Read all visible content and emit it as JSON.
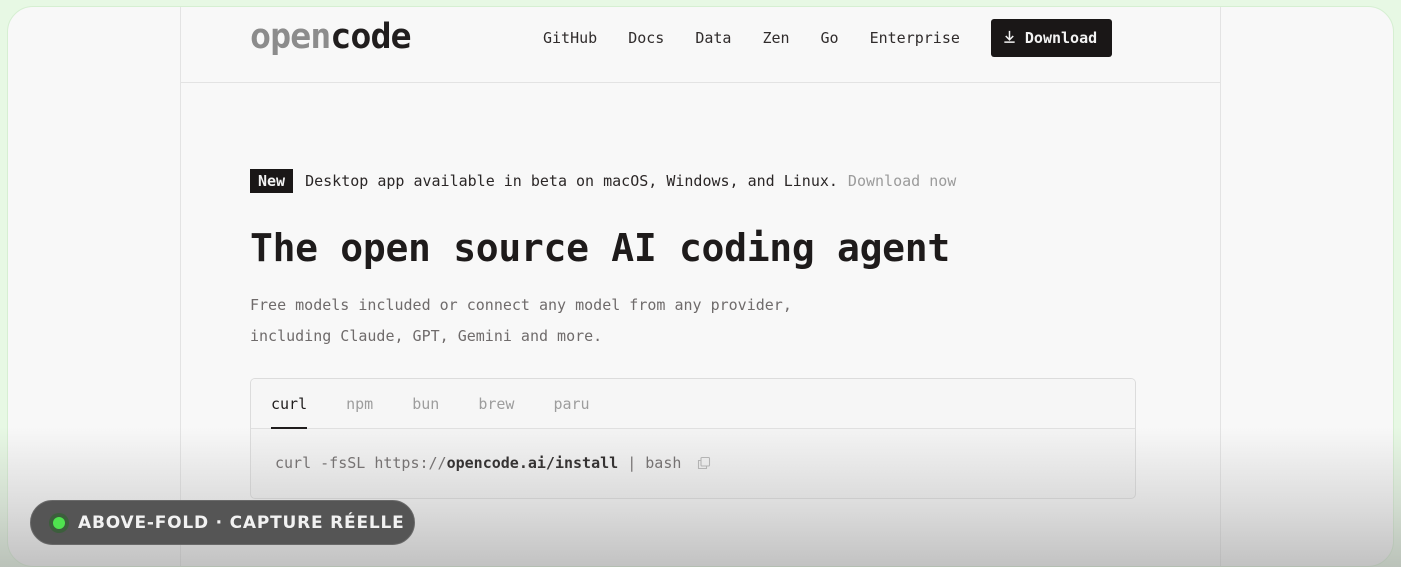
{
  "header": {
    "logo_dim": "open",
    "logo_strong": "code",
    "nav": [
      "GitHub",
      "Docs",
      "Data",
      "Zen",
      "Go",
      "Enterprise"
    ],
    "download_label": "Download"
  },
  "announcement": {
    "badge": "New",
    "text": "Desktop app available in beta on macOS, Windows, and Linux.",
    "link": "Download now"
  },
  "hero": {
    "title": "The open source AI coding agent",
    "subtitle_line1": "Free models included or connect any model from any provider,",
    "subtitle_line2": "including Claude, GPT, Gemini and more."
  },
  "install": {
    "tabs": [
      "curl",
      "npm",
      "bun",
      "brew",
      "paru"
    ],
    "active_tab": "curl",
    "command_prefix": "curl -fsSL https://",
    "command_host": "opencode.ai/install",
    "command_suffix": "| bash"
  },
  "overlay": {
    "label": "ABOVE-FOLD · CAPTURE RÉELLE",
    "status_color": "#4fe34f"
  }
}
